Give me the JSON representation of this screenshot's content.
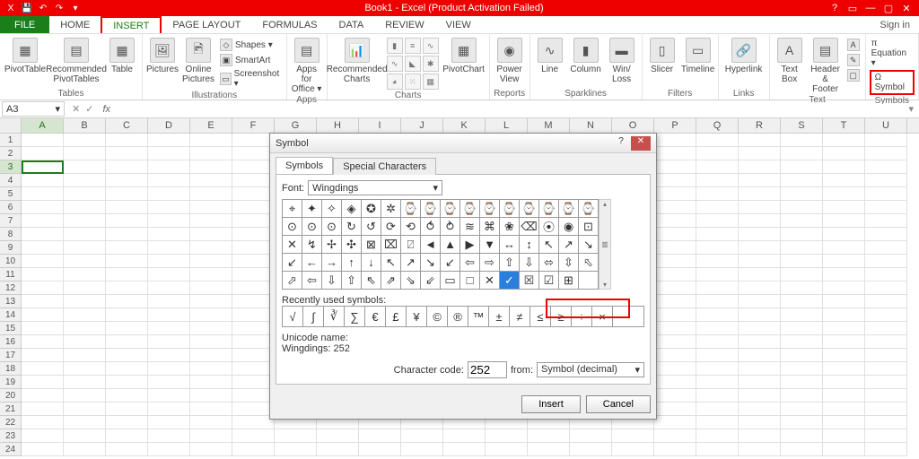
{
  "titlebar": {
    "title": "Book1 - Excel (Product Activation Failed)"
  },
  "tabs": {
    "file": "FILE",
    "list": [
      "HOME",
      "INSERT",
      "PAGE LAYOUT",
      "FORMULAS",
      "DATA",
      "REVIEW",
      "VIEW"
    ],
    "active": "INSERT",
    "signin": "Sign in"
  },
  "ribbon": {
    "tables": {
      "pivot": "PivotTable",
      "rec": "Recommended PivotTables",
      "table": "Table",
      "label": "Tables"
    },
    "illus": {
      "pics": "Pictures",
      "online": "Online Pictures",
      "shapes": "Shapes ▾",
      "smart": "SmartArt",
      "screen": "Screenshot ▾",
      "label": "Illustrations"
    },
    "apps": {
      "btn": "Apps for Office ▾",
      "label": "Apps"
    },
    "charts": {
      "rec": "Recommended Charts",
      "pivot": "PivotChart",
      "label": "Charts"
    },
    "reports": {
      "power": "Power View",
      "label": "Reports"
    },
    "spark": {
      "line": "Line",
      "col": "Column",
      "wl": "Win/ Loss",
      "label": "Sparklines"
    },
    "filters": {
      "slicer": "Slicer",
      "time": "Timeline",
      "label": "Filters"
    },
    "links": {
      "hl": "Hyperlink",
      "label": "Links"
    },
    "text": {
      "tb": "Text Box",
      "hf": "Header & Footer",
      "label": "Text"
    },
    "symbols": {
      "eq": "π Equation ▾",
      "sym": "Ω Symbol",
      "label": "Symbols"
    }
  },
  "formula": {
    "name": "A3"
  },
  "grid": {
    "cols": [
      "A",
      "B",
      "C",
      "D",
      "E",
      "F",
      "G",
      "H",
      "I",
      "J",
      "K",
      "L",
      "M",
      "N",
      "O",
      "P",
      "Q",
      "R",
      "S",
      "T",
      "U"
    ],
    "rows": 24,
    "selCol": "A",
    "selRow": 3
  },
  "dialog": {
    "title": "Symbol",
    "tabs": [
      "Symbols",
      "Special Characters"
    ],
    "fontLabel": "Font:",
    "font": "Wingdings",
    "symbols": [
      [
        "⌖",
        "✦",
        "✧",
        "◈",
        "✪",
        "✲",
        "⌚",
        "⌚",
        "⌚",
        "⌚",
        "⌚",
        "⌚",
        "⌚",
        "⌚",
        "⌚",
        "⌚"
      ],
      [
        "⊙",
        "⊙",
        "⊙",
        "↻",
        "↺",
        "⟳",
        "⟲",
        "⥀",
        "⥁",
        "≋",
        "⌘",
        "❀",
        "⌫",
        "⦿",
        "◉",
        "⊡"
      ],
      [
        "✕",
        "↯",
        "✢",
        "✣",
        "⊠",
        "⌧",
        "⍁",
        "◄",
        "▲",
        "▶",
        "▼",
        "↔",
        "↕",
        "↖",
        "↗",
        "↘"
      ],
      [
        "↙",
        "←",
        "→",
        "↑",
        "↓",
        "↖",
        "↗",
        "↘",
        "↙",
        "⇦",
        "⇨",
        "⇧",
        "⇩",
        "⬄",
        "⇳",
        "⬁"
      ],
      [
        "⬀",
        "⇦",
        "⇩",
        "⇧",
        "⇖",
        "⇗",
        "⇘",
        "⇙",
        "▭",
        "□",
        "✕",
        "✓",
        "☒",
        "☑",
        "⊞",
        ""
      ]
    ],
    "selectedIndex": [
      4,
      11
    ],
    "scrollPos": "▥",
    "recentLabel": "Recently used symbols:",
    "recent": [
      "√",
      "∫",
      "∛",
      "∑",
      "€",
      "£",
      "¥",
      "©",
      "®",
      "™",
      "±",
      "≠",
      "≤",
      "≥",
      "÷",
      "×"
    ],
    "unameLabel": "Unicode name:",
    "uname": "Wingdings: 252",
    "codeLabel": "Character code:",
    "code": "252",
    "fromLabel": "from:",
    "from": "Symbol (decimal)",
    "insert": "Insert",
    "cancel": "Cancel"
  }
}
